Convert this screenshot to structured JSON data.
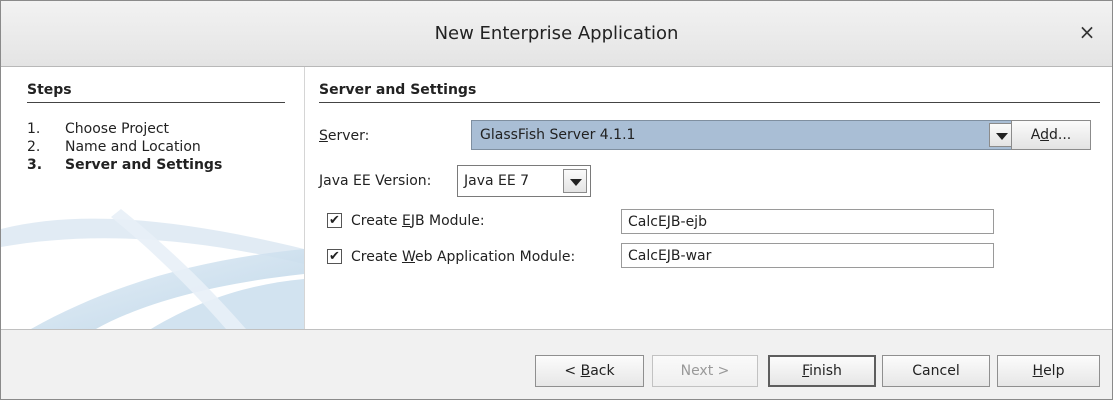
{
  "window": {
    "title": "New Enterprise Application",
    "close_glyph": "×"
  },
  "steps": {
    "heading": "Steps",
    "items": [
      {
        "num": "1.",
        "label": "Choose Project"
      },
      {
        "num": "2.",
        "label": "Name and Location"
      },
      {
        "num": "3.",
        "label": "Server and Settings"
      }
    ]
  },
  "section": {
    "heading": "Server and Settings"
  },
  "server": {
    "label_mnemonic": "S",
    "label_rest": "erver:",
    "selected": "GlassFish Server 4.1.1",
    "add_pre": "A",
    "add_mnemonic": "d",
    "add_post": "d..."
  },
  "javaee": {
    "label_mnemonic": "J",
    "label_rest": "ava EE Version:",
    "selected": "Java EE 7"
  },
  "ejb_module": {
    "checked": true,
    "check_glyph": "✔",
    "label_pre": "Create ",
    "label_mnemonic": "E",
    "label_post": "JB Module:",
    "value": "CalcEJB-ejb"
  },
  "web_module": {
    "checked": true,
    "check_glyph": "✔",
    "label_pre": "Create ",
    "label_mnemonic": "W",
    "label_post": "eb Application Module:",
    "value": "CalcEJB-war"
  },
  "buttons": {
    "back_pre": "< ",
    "back_mnemonic": "B",
    "back_post": "ack",
    "next": "Next >",
    "finish_mnemonic": "F",
    "finish_post": "inish",
    "cancel": "Cancel",
    "help_mnemonic": "H",
    "help_post": "elp"
  },
  "colors": {
    "selected_combo": "#a9bed5",
    "footer_bg": "#f1f1f1"
  }
}
